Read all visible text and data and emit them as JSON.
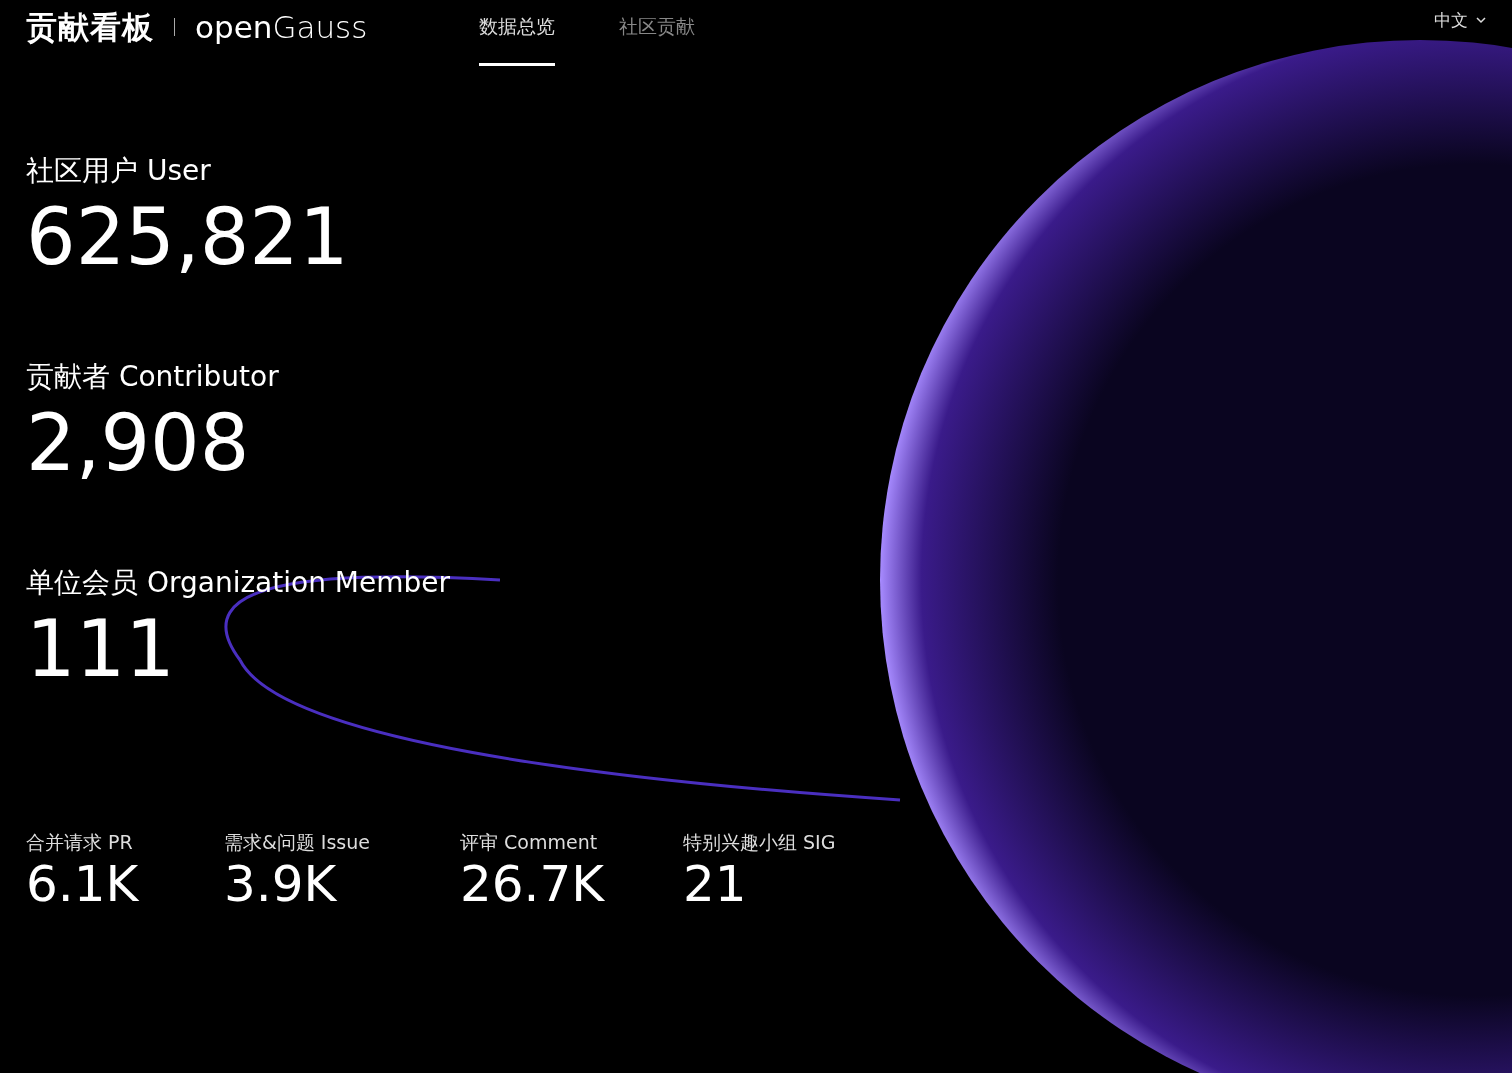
{
  "header": {
    "title": "贡献看板",
    "brand": "**open**Gauss",
    "tabs": [
      {
        "label": "数据总览",
        "selected": true
      },
      {
        "label": "社区贡献",
        "selected": false
      }
    ],
    "language": "中文"
  },
  "main_stats": [
    {
      "label": "社区用户 User",
      "value": "625,821"
    },
    {
      "label": "贡献者 Contributor",
      "value": "2,908"
    },
    {
      "label": "单位会员 Organization Member",
      "value": "111"
    }
  ],
  "small_stats": [
    {
      "label": "合并请求 PR",
      "value": "6.1K"
    },
    {
      "label": "需求&问题 Issue",
      "value": "3.9K"
    },
    {
      "label": "评审 Comment",
      "value": "26.7K"
    },
    {
      "label": "特别兴趣小组 SIG",
      "value": "21"
    }
  ]
}
